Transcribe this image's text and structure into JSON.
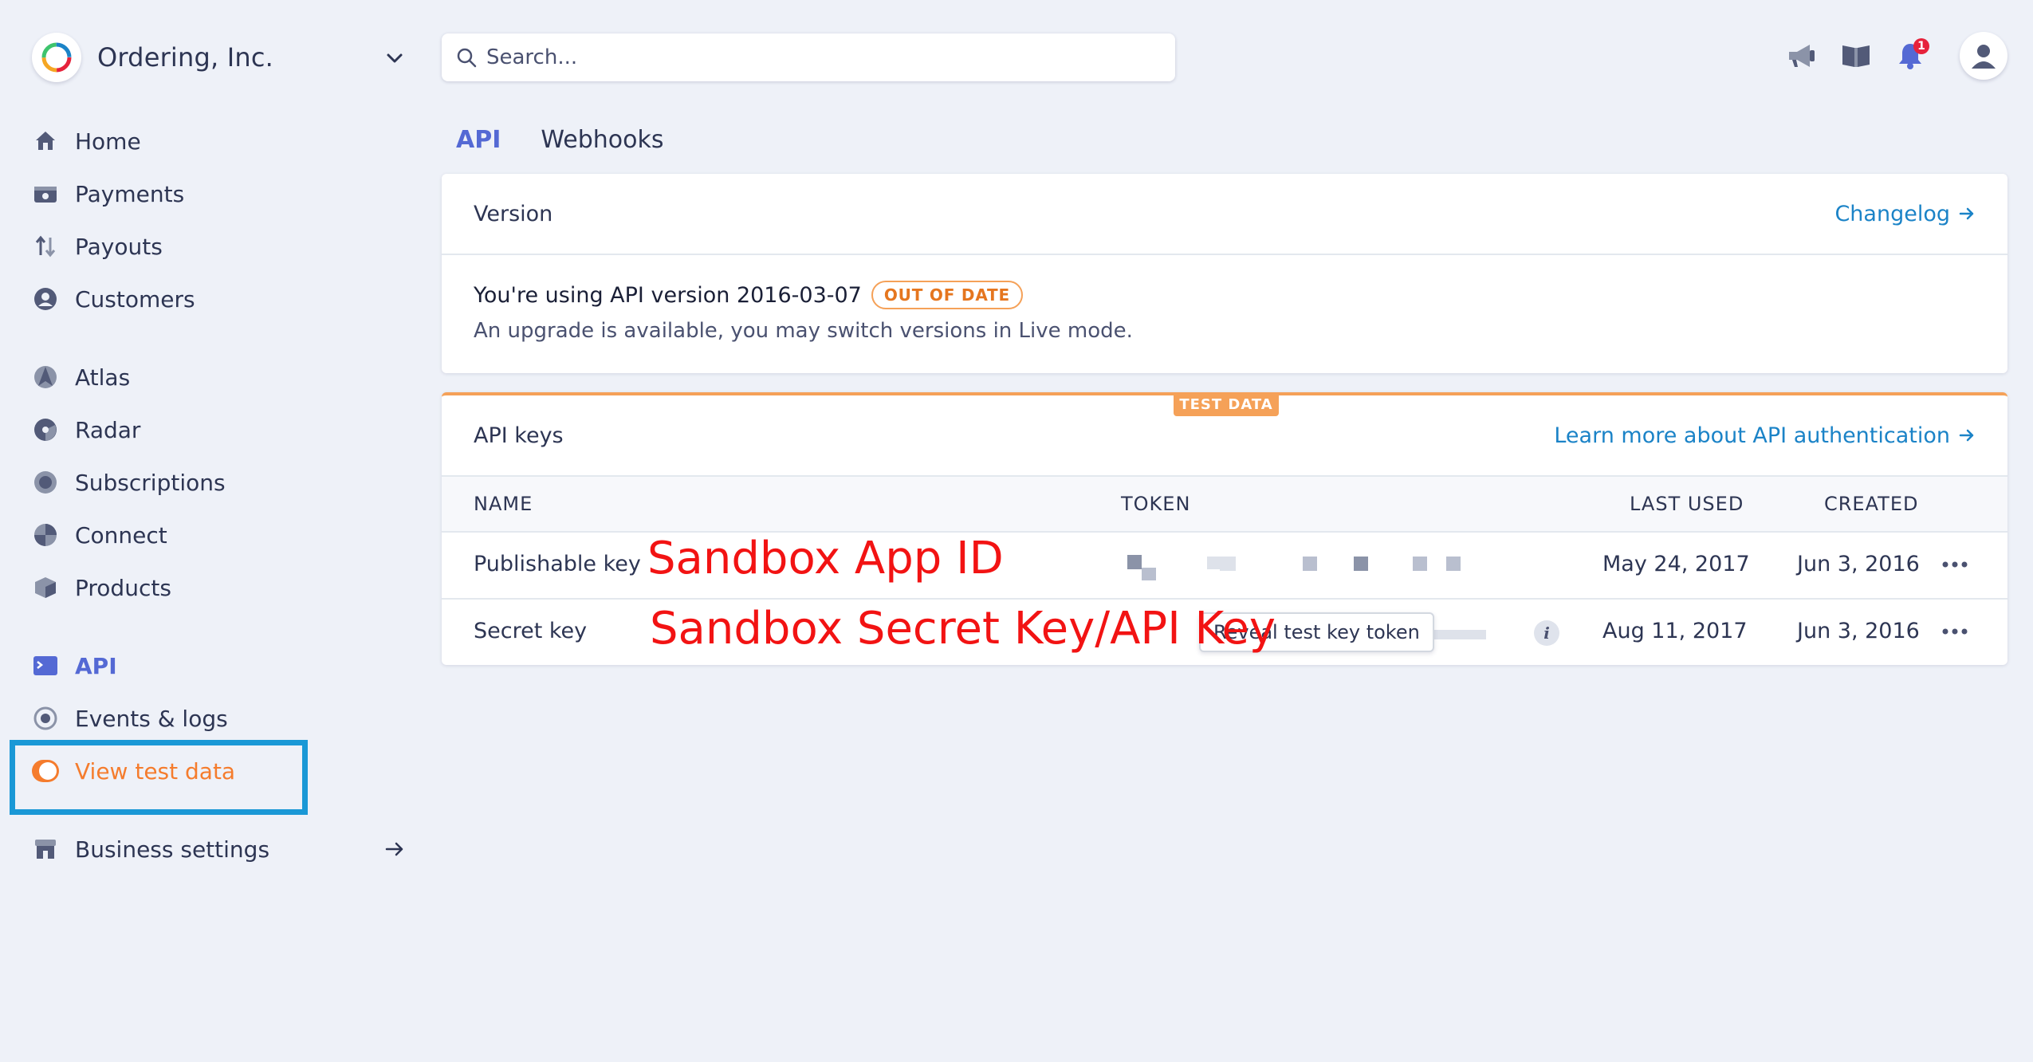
{
  "brand": {
    "name": "Ordering, Inc."
  },
  "sidebar": {
    "items": [
      {
        "label": "Home",
        "icon": "home-icon"
      },
      {
        "label": "Payments",
        "icon": "wallet-icon"
      },
      {
        "label": "Payouts",
        "icon": "transfer-arrows-icon"
      },
      {
        "label": "Customers",
        "icon": "user-circle-icon"
      },
      {
        "label": "Atlas",
        "icon": "atlas-icon"
      },
      {
        "label": "Radar",
        "icon": "radar-icon"
      },
      {
        "label": "Subscriptions",
        "icon": "subscriptions-icon"
      },
      {
        "label": "Connect",
        "icon": "connect-icon"
      },
      {
        "label": "Products",
        "icon": "box-icon"
      },
      {
        "label": "API",
        "icon": "terminal-icon"
      },
      {
        "label": "Events & logs",
        "icon": "events-icon"
      }
    ],
    "test_toggle": {
      "label": "View test data",
      "on": true
    },
    "business_settings": "Business settings"
  },
  "search": {
    "placeholder": "Search..."
  },
  "notifications": {
    "count": "1"
  },
  "tabs": [
    {
      "label": "API",
      "active": true
    },
    {
      "label": "Webhooks",
      "active": false
    }
  ],
  "version_card": {
    "title": "Version",
    "link": "Changelog",
    "line1": "You're using API version 2016-03-07",
    "badge": "OUT OF DATE",
    "line2": "An upgrade is available, you may switch versions in Live mode."
  },
  "keys_card": {
    "badge": "TEST DATA",
    "title": "API keys",
    "link": "Learn more about API authentication",
    "columns": {
      "name": "NAME",
      "token": "TOKEN",
      "last_used": "LAST USED",
      "created": "CREATED"
    },
    "rows": [
      {
        "name": "Publishable key",
        "last_used": "May 24, 2017",
        "created": "Jun 3, 2016"
      },
      {
        "name": "Secret key",
        "tooltip": "Reveal test key token",
        "last_used": "Aug 11, 2017",
        "created": "Jun 3, 2016"
      }
    ]
  },
  "annotations": {
    "publishable": "Sandbox App ID",
    "secret": "Sandbox Secret Key/API Key"
  },
  "colors": {
    "accent": "#5469d4",
    "link": "#1b83c7",
    "test": "#f57c2d",
    "annotation": "#f21313",
    "highlight_box": "#1a98d6"
  }
}
